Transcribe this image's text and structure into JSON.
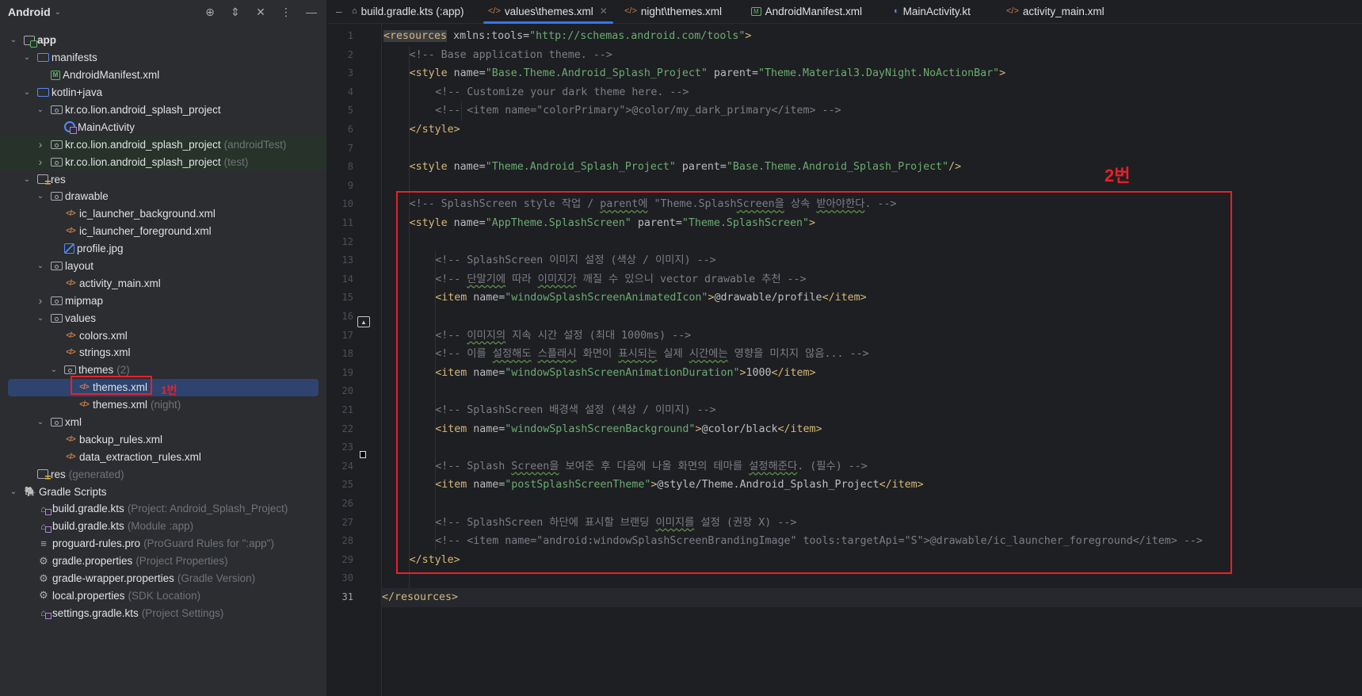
{
  "sidebar": {
    "title": "Android",
    "tools": [
      "locate-icon",
      "expand-collapse-icon",
      "close-icon",
      "more-icon"
    ],
    "tree": [
      {
        "label": "app",
        "hint": "",
        "indent": 0,
        "arrow": "down",
        "icon": "module"
      },
      {
        "label": "manifests",
        "hint": "",
        "indent": 1,
        "arrow": "down",
        "icon": "folder-blue"
      },
      {
        "label": "AndroidManifest.xml",
        "hint": "",
        "indent": 2,
        "arrow": "none",
        "icon": "manifest"
      },
      {
        "label": "kotlin+java",
        "hint": "",
        "indent": 1,
        "arrow": "down",
        "icon": "folder-blue"
      },
      {
        "label": "kr.co.lion.android_splash_project",
        "hint": "",
        "indent": 2,
        "arrow": "down",
        "icon": "package"
      },
      {
        "label": "MainActivity",
        "hint": "",
        "indent": 3,
        "arrow": "none",
        "icon": "activity"
      },
      {
        "label": "kr.co.lion.android_splash_project",
        "hint": "(androidTest)",
        "indent": 2,
        "arrow": "right",
        "icon": "package",
        "green": true
      },
      {
        "label": "kr.co.lion.android_splash_project",
        "hint": "(test)",
        "indent": 2,
        "arrow": "right",
        "icon": "package",
        "green": true
      },
      {
        "label": "res",
        "hint": "",
        "indent": 1,
        "arrow": "down",
        "icon": "res"
      },
      {
        "label": "drawable",
        "hint": "",
        "indent": 2,
        "arrow": "down",
        "icon": "package"
      },
      {
        "label": "ic_launcher_background.xml",
        "hint": "",
        "indent": 3,
        "arrow": "none",
        "icon": "xml"
      },
      {
        "label": "ic_launcher_foreground.xml",
        "hint": "",
        "indent": 3,
        "arrow": "none",
        "icon": "xml"
      },
      {
        "label": "profile.jpg",
        "hint": "",
        "indent": 3,
        "arrow": "none",
        "icon": "image"
      },
      {
        "label": "layout",
        "hint": "",
        "indent": 2,
        "arrow": "down",
        "icon": "package"
      },
      {
        "label": "activity_main.xml",
        "hint": "",
        "indent": 3,
        "arrow": "none",
        "icon": "xml"
      },
      {
        "label": "mipmap",
        "hint": "",
        "indent": 2,
        "arrow": "right",
        "icon": "package"
      },
      {
        "label": "values",
        "hint": "",
        "indent": 2,
        "arrow": "down",
        "icon": "package"
      },
      {
        "label": "colors.xml",
        "hint": "",
        "indent": 3,
        "arrow": "none",
        "icon": "xml"
      },
      {
        "label": "strings.xml",
        "hint": "",
        "indent": 3,
        "arrow": "none",
        "icon": "xml"
      },
      {
        "label": "themes",
        "hint": "(2)",
        "indent": 3,
        "arrow": "down",
        "icon": "package"
      },
      {
        "label": "themes.xml",
        "hint": "",
        "indent": 4,
        "arrow": "none",
        "icon": "xml",
        "selected": true
      },
      {
        "label": "themes.xml",
        "hint": "(night)",
        "indent": 4,
        "arrow": "none",
        "icon": "xml"
      },
      {
        "label": "xml",
        "hint": "",
        "indent": 2,
        "arrow": "down",
        "icon": "package"
      },
      {
        "label": "backup_rules.xml",
        "hint": "",
        "indent": 3,
        "arrow": "none",
        "icon": "xml"
      },
      {
        "label": "data_extraction_rules.xml",
        "hint": "",
        "indent": 3,
        "arrow": "none",
        "icon": "xml"
      },
      {
        "label": "res",
        "hint": "(generated)",
        "indent": 1,
        "arrow": "none",
        "icon": "res"
      },
      {
        "label": "Gradle Scripts",
        "hint": "",
        "indent": 0,
        "arrow": "down",
        "icon": "gradle"
      },
      {
        "label": "build.gradle.kts",
        "hint": "(Project: Android_Splash_Project)",
        "indent": 1,
        "arrow": "none",
        "icon": "gradle-kts"
      },
      {
        "label": "build.gradle.kts",
        "hint": "(Module :app)",
        "indent": 1,
        "arrow": "none",
        "icon": "gradle-kts"
      },
      {
        "label": "proguard-rules.pro",
        "hint": "(ProGuard Rules for \":app\")",
        "indent": 1,
        "arrow": "none",
        "icon": "lines"
      },
      {
        "label": "gradle.properties",
        "hint": "(Project Properties)",
        "indent": 1,
        "arrow": "none",
        "icon": "gear"
      },
      {
        "label": "gradle-wrapper.properties",
        "hint": "(Gradle Version)",
        "indent": 1,
        "arrow": "none",
        "icon": "gear"
      },
      {
        "label": "local.properties",
        "hint": "(SDK Location)",
        "indent": 1,
        "arrow": "none",
        "icon": "gear"
      },
      {
        "label": "settings.gradle.kts",
        "hint": "(Project Settings)",
        "indent": 1,
        "arrow": "none",
        "icon": "gradle-kts"
      }
    ]
  },
  "annotations": {
    "label_1": "1번",
    "label_2": "2번",
    "color": "#e8202b"
  },
  "tabs": [
    {
      "label": "build.gradle.kts (:app)",
      "icon": "gradle-kts",
      "active": false
    },
    {
      "label": "values\\themes.xml",
      "icon": "xml",
      "active": true,
      "closable": true
    },
    {
      "label": "night\\themes.xml",
      "icon": "xml",
      "active": false
    },
    {
      "label": "AndroidManifest.xml",
      "icon": "manifest",
      "active": false
    },
    {
      "label": "MainActivity.kt",
      "icon": "activity",
      "active": false
    },
    {
      "label": "activity_main.xml",
      "icon": "xml",
      "active": false
    }
  ],
  "editor": {
    "current_line": 31,
    "lines": [
      {
        "n": 1,
        "indent": 0,
        "tokens": [
          [
            "tg hl",
            "<resources"
          ],
          [
            "at",
            " xmlns:tools"
          ],
          [
            "tx",
            "="
          ],
          [
            "st",
            "\"http://schemas.android.com/tools\""
          ],
          [
            "tg",
            ">"
          ]
        ]
      },
      {
        "n": 2,
        "indent": 1,
        "tokens": [
          [
            "cm",
            "<!-- Base application theme. -->"
          ]
        ]
      },
      {
        "n": 3,
        "indent": 1,
        "tokens": [
          [
            "tg",
            "<style"
          ],
          [
            "at",
            " name"
          ],
          [
            "tx",
            "="
          ],
          [
            "st",
            "\"Base.Theme.Android_Splash_Project\""
          ],
          [
            "at",
            " parent"
          ],
          [
            "tx",
            "="
          ],
          [
            "st",
            "\"Theme.Material3.DayNight.NoActionBar\""
          ],
          [
            "tg",
            ">"
          ]
        ]
      },
      {
        "n": 4,
        "indent": 2,
        "tokens": [
          [
            "cm",
            "<!-- Customize your dark theme here. -->"
          ]
        ]
      },
      {
        "n": 5,
        "indent": 2,
        "tokens": [
          [
            "cm",
            "<!-- <item name=\"colorPrimary\">@color/my_dark_primary</item> -->"
          ]
        ]
      },
      {
        "n": 6,
        "indent": 1,
        "tokens": [
          [
            "tg",
            "</style>"
          ]
        ]
      },
      {
        "n": 7,
        "indent": 0,
        "tokens": []
      },
      {
        "n": 8,
        "indent": 1,
        "tokens": [
          [
            "tg",
            "<style"
          ],
          [
            "at",
            " name"
          ],
          [
            "tx",
            "="
          ],
          [
            "st",
            "\"Theme.Android_Splash_Project\""
          ],
          [
            "at",
            " parent"
          ],
          [
            "tx",
            "="
          ],
          [
            "st",
            "\"Base.Theme.Android_Splash_Project\""
          ],
          [
            "tg",
            "/>"
          ]
        ]
      },
      {
        "n": 9,
        "indent": 0,
        "tokens": []
      },
      {
        "n": 10,
        "indent": 1,
        "tokens": [
          [
            "cm",
            "<!-- SplashScreen style 작업 / "
          ],
          [
            "cm wavy",
            "parent에"
          ],
          [
            "cm",
            " \"Theme.Splash"
          ],
          [
            "cm wavy",
            "Screen을"
          ],
          [
            "cm",
            " 상속 "
          ],
          [
            "cm wavy",
            "받아야한다"
          ],
          [
            "cm",
            ". -->"
          ]
        ]
      },
      {
        "n": 11,
        "indent": 1,
        "tokens": [
          [
            "tg",
            "<style"
          ],
          [
            "at",
            " name"
          ],
          [
            "tx",
            "="
          ],
          [
            "st",
            "\"AppTheme.SplashScreen\""
          ],
          [
            "at",
            " parent"
          ],
          [
            "tx",
            "="
          ],
          [
            "st",
            "\"Theme.SplashScreen\""
          ],
          [
            "tg",
            ">"
          ]
        ]
      },
      {
        "n": 12,
        "indent": 0,
        "tokens": []
      },
      {
        "n": 13,
        "indent": 2,
        "tokens": [
          [
            "cm",
            "<!-- SplashScreen 이미지 설정 (색상 / 이미지) -->"
          ]
        ]
      },
      {
        "n": 14,
        "indent": 2,
        "tokens": [
          [
            "cm",
            "<!-- "
          ],
          [
            "cm wavy",
            "단말기에"
          ],
          [
            "cm",
            " 따라 "
          ],
          [
            "cm wavy",
            "이미지가"
          ],
          [
            "cm",
            " 깨질 수 있으니 vector drawable 추천 -->"
          ]
        ]
      },
      {
        "n": 15,
        "indent": 2,
        "tokens": [
          [
            "tg",
            "<item"
          ],
          [
            "at",
            " name"
          ],
          [
            "tx",
            "="
          ],
          [
            "st",
            "\"windowSplashScreenAnimatedIcon\""
          ],
          [
            "tg",
            ">"
          ],
          [
            "tx",
            "@drawable/profile"
          ],
          [
            "tg",
            "</item>"
          ]
        ]
      },
      {
        "n": 16,
        "indent": 0,
        "tokens": []
      },
      {
        "n": 17,
        "indent": 2,
        "tokens": [
          [
            "cm",
            "<!-- "
          ],
          [
            "cm wavy",
            "이미지의"
          ],
          [
            "cm",
            " 지속 시간 설정 (최대 1000ms) -->"
          ]
        ]
      },
      {
        "n": 18,
        "indent": 2,
        "tokens": [
          [
            "cm",
            "<!-- 이를 "
          ],
          [
            "cm wavy",
            "설정해도"
          ],
          [
            "cm",
            " "
          ],
          [
            "cm wavy",
            "스플래시"
          ],
          [
            "cm",
            " 화면이 "
          ],
          [
            "cm wavy",
            "표시되는"
          ],
          [
            "cm",
            " 실제 "
          ],
          [
            "cm wavy",
            "시간에는"
          ],
          [
            "cm",
            " 영향을 미치지 않음... -->"
          ]
        ]
      },
      {
        "n": 19,
        "indent": 2,
        "tokens": [
          [
            "tg",
            "<item"
          ],
          [
            "at",
            " name"
          ],
          [
            "tx",
            "="
          ],
          [
            "st",
            "\"windowSplashScreenAnimationDuration\""
          ],
          [
            "tg",
            ">"
          ],
          [
            "tx",
            "1000"
          ],
          [
            "tg",
            "</item>"
          ]
        ]
      },
      {
        "n": 20,
        "indent": 0,
        "tokens": []
      },
      {
        "n": 21,
        "indent": 2,
        "tokens": [
          [
            "cm",
            "<!-- SplashScreen 배경색 설정 (색상 / 이미지) -->"
          ]
        ]
      },
      {
        "n": 22,
        "indent": 2,
        "tokens": [
          [
            "tg",
            "<item"
          ],
          [
            "at",
            " name"
          ],
          [
            "tx",
            "="
          ],
          [
            "st",
            "\"windowSplashScreenBackground\""
          ],
          [
            "tg",
            ">"
          ],
          [
            "tx",
            "@color/black"
          ],
          [
            "tg",
            "</item>"
          ]
        ]
      },
      {
        "n": 23,
        "indent": 0,
        "tokens": []
      },
      {
        "n": 24,
        "indent": 2,
        "tokens": [
          [
            "cm",
            "<!-- Splash "
          ],
          [
            "cm wavy",
            "Screen을"
          ],
          [
            "cm",
            " 보여준 후 다음에 나올 화면의 테마를 "
          ],
          [
            "cm wavy",
            "설정해준다"
          ],
          [
            "cm",
            ". (필수) -->"
          ]
        ]
      },
      {
        "n": 25,
        "indent": 2,
        "tokens": [
          [
            "tg",
            "<item"
          ],
          [
            "at",
            " name"
          ],
          [
            "tx",
            "="
          ],
          [
            "st",
            "\"postSplashScreenTheme\""
          ],
          [
            "tg",
            ">"
          ],
          [
            "tx",
            "@style/Theme.Android_Splash_Project"
          ],
          [
            "tg",
            "</item>"
          ]
        ]
      },
      {
        "n": 26,
        "indent": 0,
        "tokens": []
      },
      {
        "n": 27,
        "indent": 2,
        "tokens": [
          [
            "cm",
            "<!-- SplashScreen 하단에 표시할 브랜딩 "
          ],
          [
            "cm wavy",
            "이미지를"
          ],
          [
            "cm",
            " 설정 (권장 X) -->"
          ]
        ]
      },
      {
        "n": 28,
        "indent": 2,
        "tokens": [
          [
            "cm",
            "<!-- <item name=\"android:windowSplashScreenBrandingImage\" tools:targetApi=\"S\">@drawable/ic_launcher_foreground</item> -->"
          ]
        ]
      },
      {
        "n": 29,
        "indent": 1,
        "tokens": [
          [
            "tg",
            "</style>"
          ]
        ]
      },
      {
        "n": 30,
        "indent": 0,
        "tokens": []
      },
      {
        "n": 31,
        "indent": 0,
        "tokens": [
          [
            "tg",
            "</resources>"
          ]
        ]
      }
    ]
  }
}
